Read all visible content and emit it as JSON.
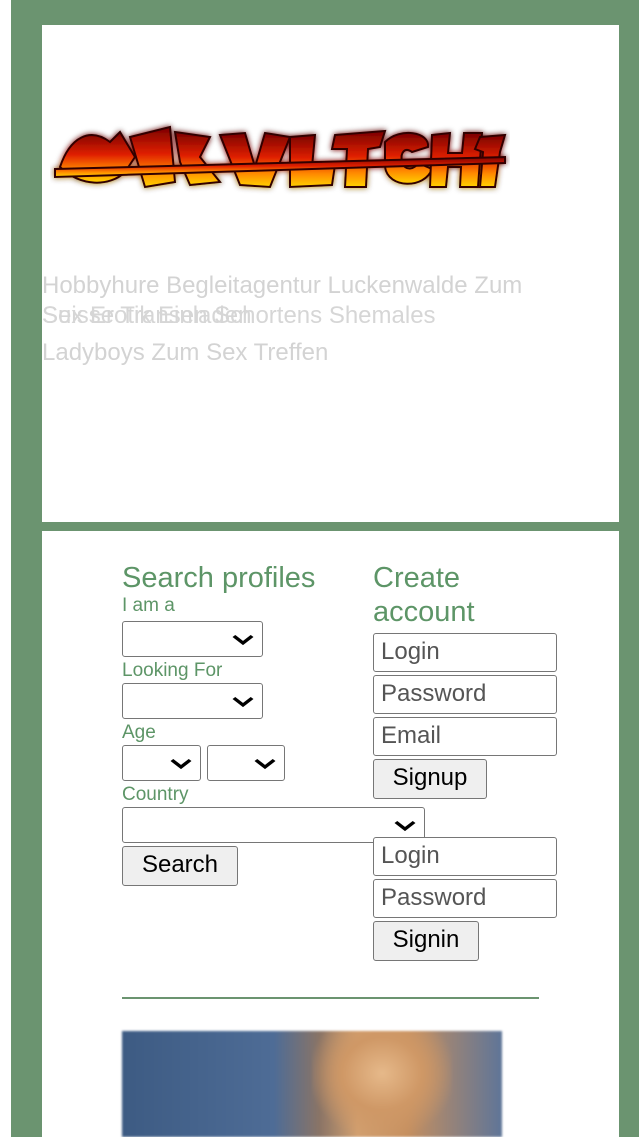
{
  "logo": {
    "alt": "AduktChat"
  },
  "headline": {
    "line1": "Hobbyhure Begleitagentur Luckenwalde Zum",
    "line1b": "Sex Erotik Einladen",
    "line2": "Suisse Transen Schortens Shemales",
    "line3": "Ladyboys Zum Sex Treffen"
  },
  "search": {
    "title": "Search profiles",
    "i_am_label": "I am a",
    "looking_for_label": "Looking For",
    "age_label": "Age",
    "country_label": "Country",
    "button": "Search"
  },
  "create": {
    "title_line1": "Create",
    "title_line2": "account",
    "login_placeholder": "Login",
    "password_placeholder": "Password",
    "email_placeholder": "Email",
    "signup_button": "Signup"
  },
  "signin": {
    "login_placeholder": "Login",
    "password_placeholder": "Password",
    "signin_button": "Signin"
  },
  "colors": {
    "background": "#6b9470",
    "accent_green": "#5d9567",
    "headline_gray": "#d3d3d3"
  }
}
